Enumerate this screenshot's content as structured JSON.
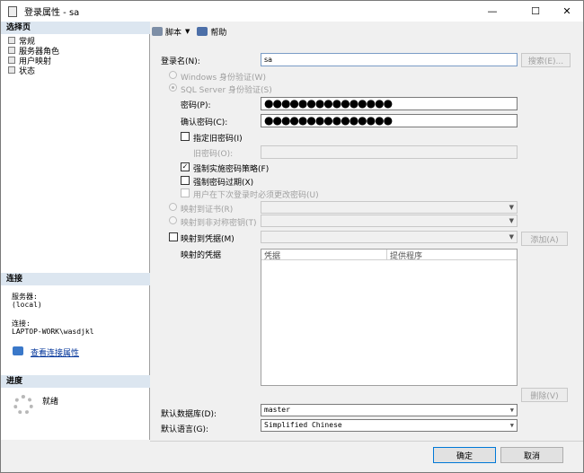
{
  "window": {
    "title": "登录属性 - sa"
  },
  "sidebar": {
    "pages_header": "选择页",
    "pages": [
      "常规",
      "服务器角色",
      "用户映射",
      "状态"
    ],
    "connection_header": "连接",
    "server_label": "服务器:",
    "server_value": "(local)",
    "conn_label": "连接:",
    "conn_value": "LAPTOP-WORK\\wasdjkl",
    "view_conn_link": "查看连接属性",
    "progress_header": "进度",
    "progress_status": "就绪"
  },
  "toolbar": {
    "script_label": "脚本",
    "help_label": "帮助"
  },
  "form": {
    "login_name_label": "登录名(N):",
    "login_name_value": "sa",
    "search_button": "搜索(E)...",
    "windows_auth_label": "Windows 身份验证(W)",
    "sql_auth_label": "SQL Server 身份验证(S)",
    "password_label": "密码(P):",
    "password_value": "●●●●●●●●●●●●●●●",
    "confirm_label": "确认密码(C):",
    "confirm_value": "●●●●●●●●●●●●●●●",
    "specify_old_label": "指定旧密码(I)",
    "old_password_label": "旧密码(O):",
    "enforce_policy_label": "强制实施密码策略(F)",
    "enforce_policy_checked": true,
    "enforce_expiry_label": "强制密码过期(X)",
    "must_change_label": "用户在下次登录时必须更改密码(U)",
    "map_cert_label": "映射到证书(R)",
    "map_asym_label": "映射到非对称密钥(T)",
    "map_cred_label": "映射到凭据(M)",
    "add_button": "添加(A)",
    "mapped_cred_label": "映射的凭据",
    "grid_col_cred": "凭据",
    "grid_col_provider": "提供程序",
    "remove_button": "删除(V)",
    "default_db_label": "默认数据库(D):",
    "default_db_value": "master",
    "default_lang_label": "默认语言(G):",
    "default_lang_value": "Simplified Chinese"
  },
  "footer": {
    "ok": "确定",
    "cancel": "取消"
  }
}
